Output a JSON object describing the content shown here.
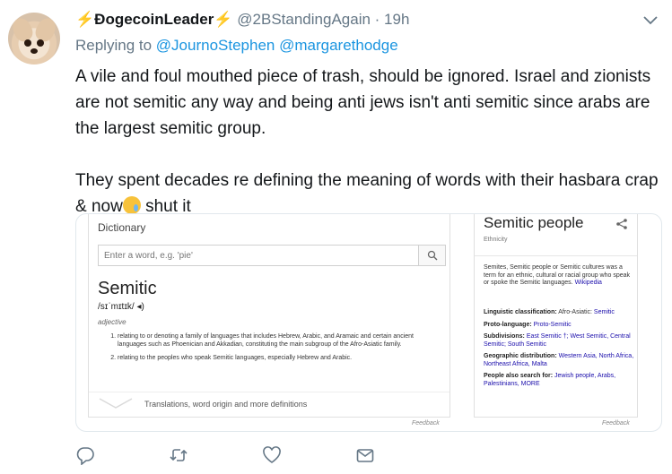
{
  "tweet": {
    "display_name": "ÐogecoinLeader",
    "bolt_left": "⚡",
    "bolt_right": "⚡",
    "handle": "@2BStandingAgain",
    "separator": " · ",
    "time": "19h",
    "replying_label": "Replying to ",
    "reply_to_1": "@JournoStephen",
    "reply_to_2": "@margarethodge",
    "text_p1": "A vile and foul mouthed piece of trash, should be ignored.  Israel and zionists are not semitic any way and being anti jews isn't anti semitic since arabs are the largest semitic group.",
    "text_p2_a": "They spent decades re defining the meaning of words with their hasbara crap & now",
    "text_p2_b": " shut it",
    "emoji": "crying-face-emoji"
  },
  "dictionary": {
    "title": "Dictionary",
    "search_placeholder": "Enter a word, e.g. 'pie'",
    "word": "Semitic",
    "pronunciation": "/sɪˈmɪtɪk/",
    "part_of_speech": "adjective",
    "definitions": [
      "relating to or denoting a family of languages that includes Hebrew, Arabic, and Aramaic and certain ancient languages such as Phoenician and Akkadian, constituting the main subgroup of the Afro-Asiatic family.",
      "relating to the peoples who speak Semitic languages, especially Hebrew and Arabic."
    ],
    "more_label": "Translations, word origin and more definitions",
    "feedback": "Feedback"
  },
  "knowledge_panel": {
    "title": "Semitic people",
    "subtitle": "Ethnicity",
    "description": "Semites, Semitic people or Semitic cultures was a term for an ethnic, cultural or racial group who speak or spoke the Semitic languages.",
    "description_link": "Wikipedia",
    "facts": [
      {
        "label": "Linguistic classification:",
        "plain": " Afro-Asiatic: ",
        "link": "Semitic"
      },
      {
        "label": "Proto-language:",
        "plain": " ",
        "link": "Proto-Semitic"
      },
      {
        "label": "Subdivisions:",
        "plain": " ",
        "link": "East Semitic †; West Semitic, Central Semitic; South Semitic"
      },
      {
        "label": "Geographic distribution:",
        "plain": " ",
        "link": "Western Asia, North Africa, Northeast Africa, Malta"
      },
      {
        "label": "People also search for:",
        "plain": " ",
        "link": "Jewish people, Arabs, Palestinians, MORE"
      }
    ],
    "feedback": "Feedback"
  },
  "actions": [
    "reply-icon",
    "retweet-icon",
    "like-icon",
    "message-icon"
  ],
  "colors": {
    "link_blue": "#1b95e0",
    "muted": "#657786",
    "google_link": "#1a0dab",
    "bolt": "#f5b300"
  }
}
